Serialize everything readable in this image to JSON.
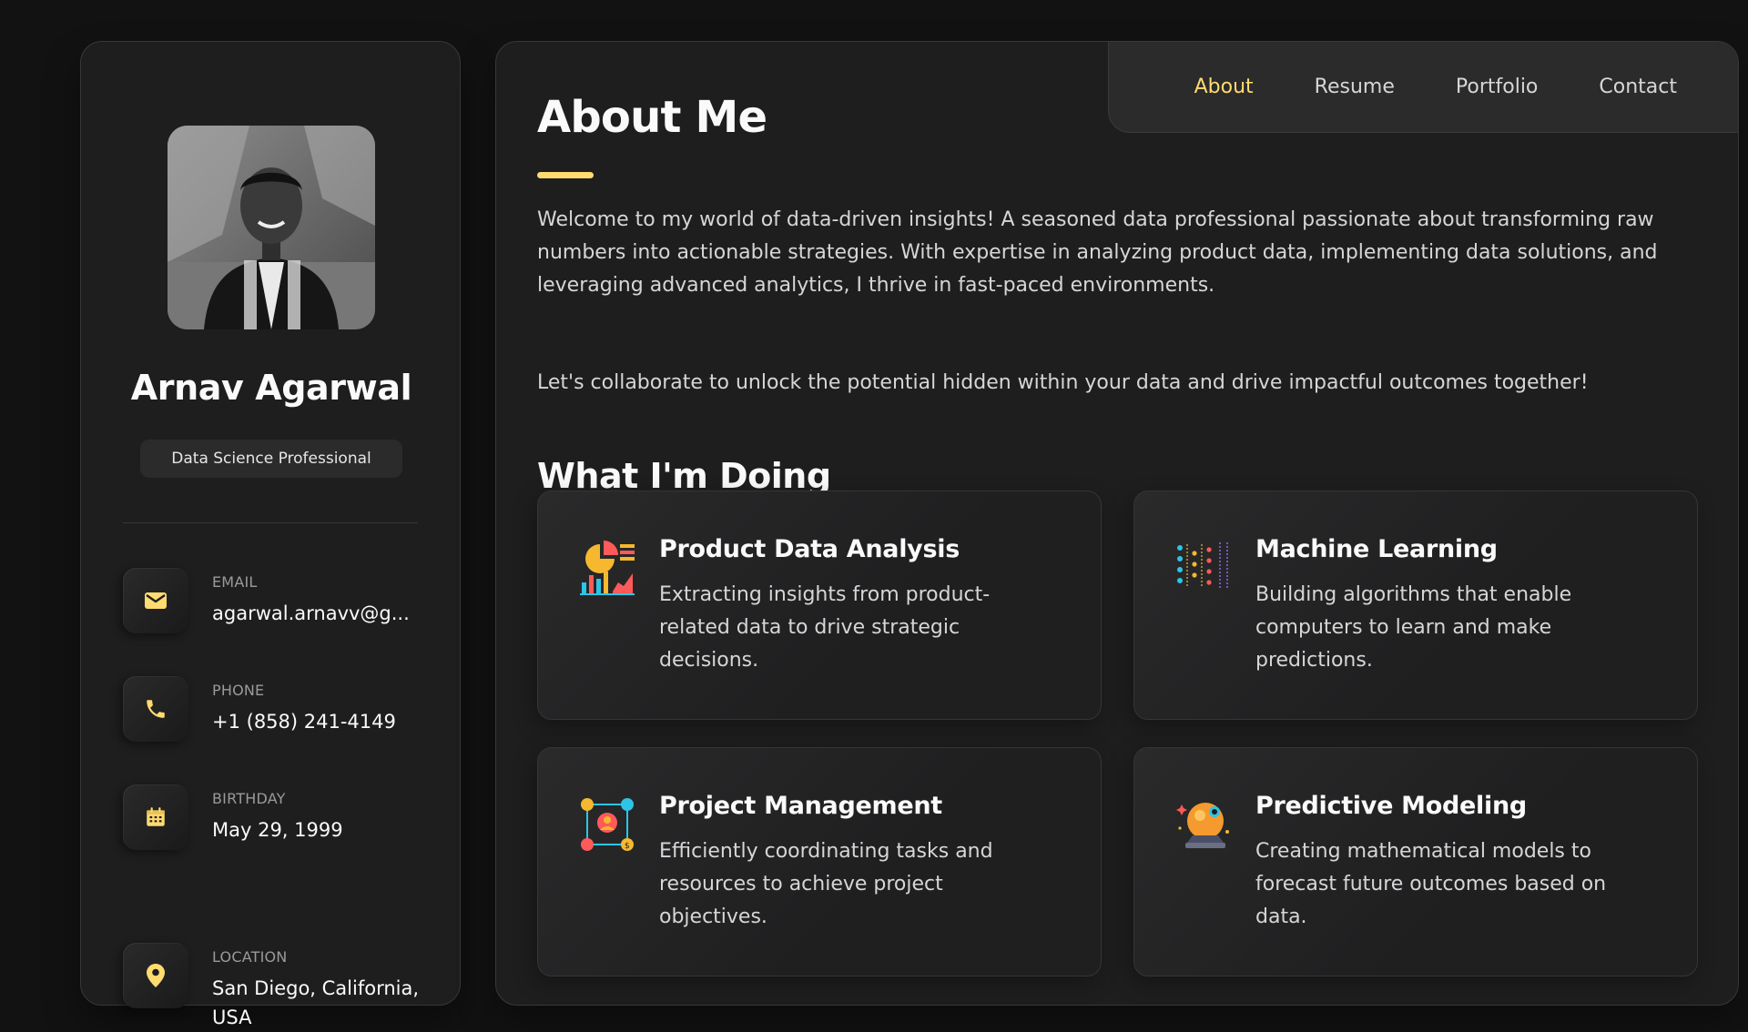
{
  "sidebar": {
    "name": "Arnav Agarwal",
    "title": "Data Science Professional",
    "contacts": [
      {
        "label": "Email",
        "value": "agarwal.arnavv@g...",
        "icon": "mail-icon"
      },
      {
        "label": "Phone",
        "value": "+1 (858) 241-4149",
        "icon": "phone-icon"
      },
      {
        "label": "Birthday",
        "value": "May 29, 1999",
        "icon": "calendar-icon"
      },
      {
        "label": "Location",
        "value": "San Diego, California, USA",
        "icon": "location-pin-icon"
      }
    ]
  },
  "nav": {
    "items": [
      "About",
      "Resume",
      "Portfolio",
      "Contact"
    ],
    "active": "About"
  },
  "about": {
    "title": "About Me",
    "paragraphs": [
      "Welcome to my world of data-driven insights! A seasoned data professional passionate about transforming raw numbers into actionable strategies. With expertise in analyzing product data, implementing data solutions, and leveraging advanced analytics, I thrive in fast-paced environments.",
      "Let's collaborate to unlock the potential hidden within your data and drive impactful outcomes together!"
    ]
  },
  "services": {
    "title": "What I'm Doing",
    "items": [
      {
        "title": "Product Data Analysis",
        "text": "Extracting insights from product-related data to drive strategic decisions.",
        "icon": "analytics-chart-icon"
      },
      {
        "title": "Machine Learning",
        "text": "Building algorithms that enable computers to learn and make predictions.",
        "icon": "neural-network-icon"
      },
      {
        "title": "Project Management",
        "text": "Efficiently coordinating tasks and resources to achieve project objectives.",
        "icon": "project-management-icon"
      },
      {
        "title": "Predictive Modeling",
        "text": "Creating mathematical models to forecast future outcomes based on data.",
        "icon": "crystal-ball-icon"
      }
    ]
  },
  "colors": {
    "accent": "#ffdb70",
    "background": "#121213",
    "panel": "#1e1e1f"
  }
}
